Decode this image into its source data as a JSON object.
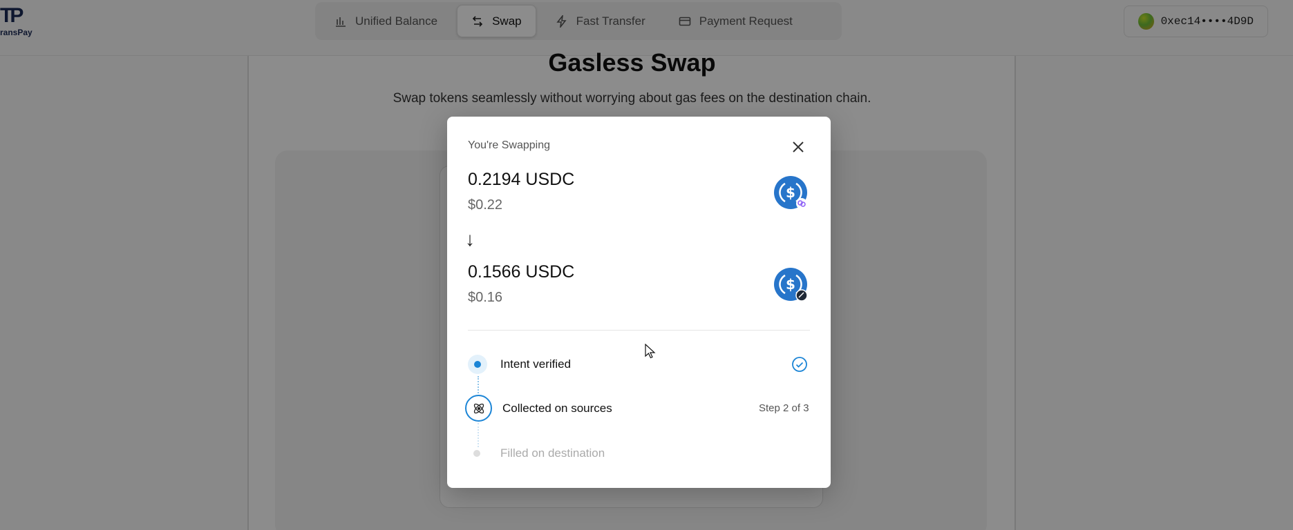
{
  "header": {
    "logo_mark": "TP",
    "logo_word": "ransPay",
    "nav": [
      {
        "label": "Unified Balance",
        "icon": "bar-chart-icon"
      },
      {
        "label": "Swap",
        "icon": "swap-icon",
        "active": true
      },
      {
        "label": "Fast Transfer",
        "icon": "lightning-icon"
      },
      {
        "label": "Payment Request",
        "icon": "card-icon"
      }
    ],
    "wallet_address": "0xec14••••4D9D"
  },
  "page": {
    "title": "Gasless Swap",
    "subtitle": "Swap tokens seamlessly without worrying about gas fees on the destination chain."
  },
  "modal": {
    "label": "You're Swapping",
    "from": {
      "amount": "0.2194 USDC",
      "usd": "$0.22",
      "icon": "usdc-coin-icon"
    },
    "arrow": "↓",
    "to": {
      "amount": "0.1566 USDC",
      "usd": "$0.16",
      "icon": "usdc-coin-icon"
    },
    "steps": [
      {
        "label": "Intent verified",
        "status": "done"
      },
      {
        "label": "Collected on sources",
        "status": "active"
      },
      {
        "label": "Filled on destination",
        "status": "pending"
      }
    ],
    "step_count": "Step 2 of 3"
  },
  "colors": {
    "accent": "#1c85d6",
    "usdc_blue": "#2775ca"
  }
}
